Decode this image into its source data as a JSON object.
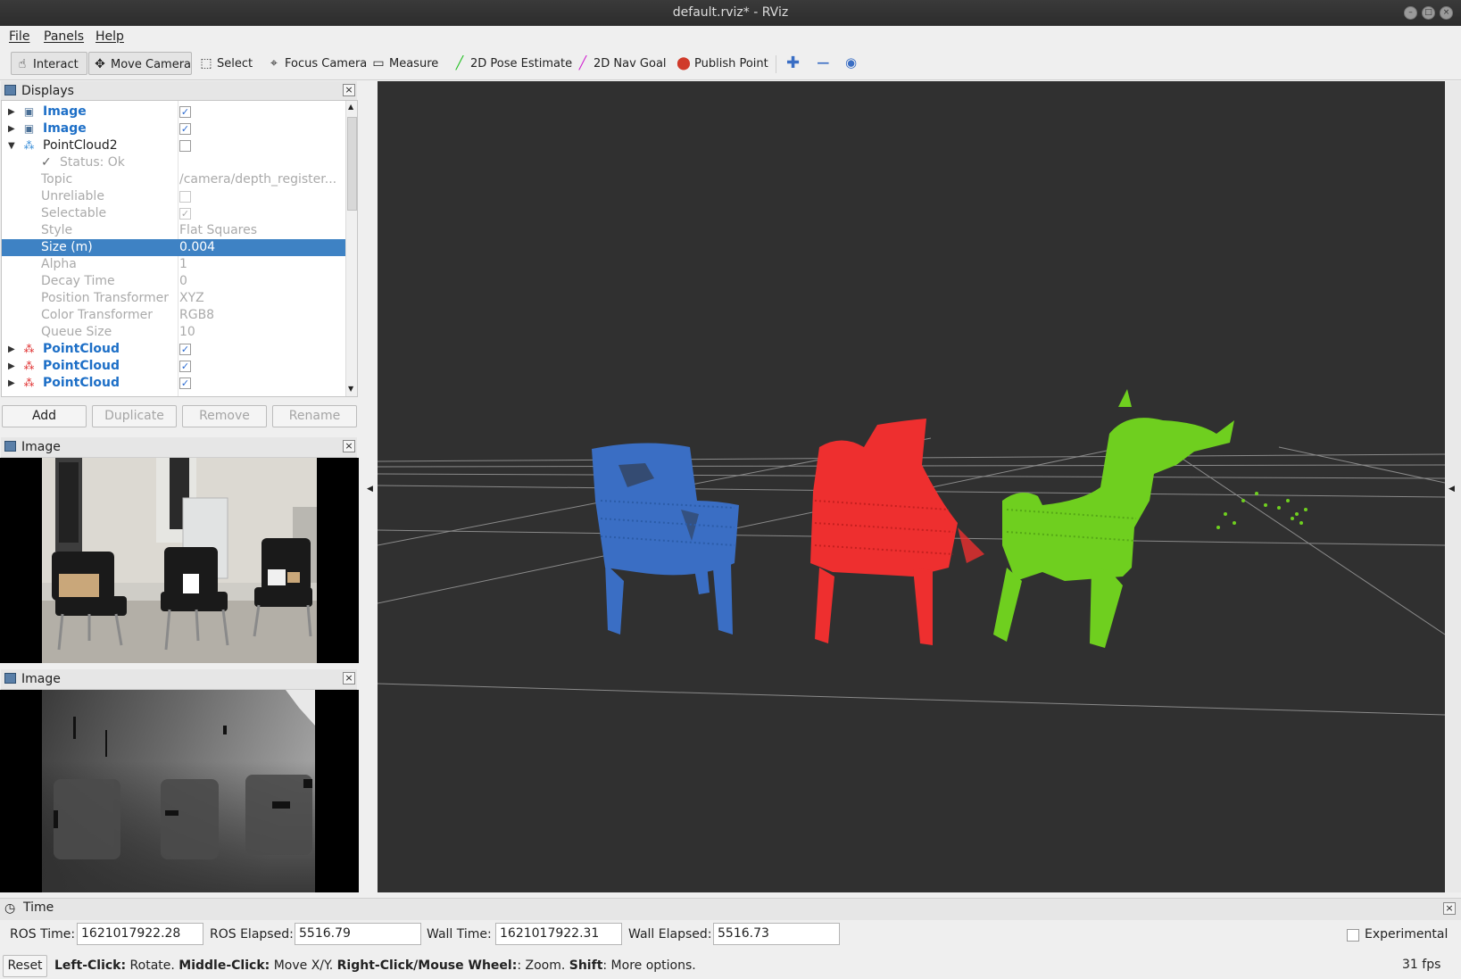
{
  "window": {
    "title": "default.rviz* - RViz"
  },
  "menu": {
    "file": "File",
    "panels": "Panels",
    "help": "Help"
  },
  "toolbar": {
    "interact": "Interact",
    "move_camera": "Move Camera",
    "select": "Select",
    "focus_camera": "Focus Camera",
    "measure": "Measure",
    "pose_estimate": "2D Pose Estimate",
    "nav_goal": "2D Nav Goal",
    "publish_point": "Publish Point"
  },
  "displays": {
    "title": "Displays",
    "rows": [
      {
        "label": "Image",
        "checked": true
      },
      {
        "label": "Image",
        "checked": true
      },
      {
        "label": "PointCloud2",
        "checked": false
      },
      {
        "label": "Status: Ok"
      },
      {
        "label": "Topic",
        "value": "/camera/depth_register..."
      },
      {
        "label": "Unreliable",
        "checked": false
      },
      {
        "label": "Selectable",
        "checked": true
      },
      {
        "label": "Style",
        "value": "Flat Squares"
      },
      {
        "label": "Size (m)",
        "value": "0.004"
      },
      {
        "label": "Alpha",
        "value": "1"
      },
      {
        "label": "Decay Time",
        "value": "0"
      },
      {
        "label": "Position Transformer",
        "value": "XYZ"
      },
      {
        "label": "Color Transformer",
        "value": "RGB8"
      },
      {
        "label": "Queue Size",
        "value": "10"
      },
      {
        "label": "PointCloud",
        "checked": true
      },
      {
        "label": "PointCloud",
        "checked": true
      },
      {
        "label": "PointCloud",
        "checked": true
      }
    ],
    "buttons": {
      "add": "Add",
      "duplicate": "Duplicate",
      "remove": "Remove",
      "rename": "Rename"
    }
  },
  "image_panels": [
    {
      "title": "Image"
    },
    {
      "title": "Image"
    }
  ],
  "time_panel": {
    "title": "Time",
    "ros_time_label": "ROS Time:",
    "ros_time": "1621017922.28",
    "ros_elapsed_label": "ROS Elapsed:",
    "ros_elapsed": "5516.79",
    "wall_time_label": "Wall Time:",
    "wall_time": "1621017922.31",
    "wall_elapsed_label": "Wall Elapsed:",
    "wall_elapsed": "5516.73",
    "experimental": "Experimental"
  },
  "status": {
    "reset": "Reset",
    "left_click": "Left-Click:",
    "left_click_desc": " Rotate. ",
    "middle_click": "Middle-Click:",
    "middle_click_desc": " Move X/Y. ",
    "right_click": "Right-Click/Mouse Wheel:",
    "right_click_desc": ": Zoom. ",
    "shift": "Shift",
    "shift_desc": ": More options.",
    "fps": "31 fps"
  },
  "colors": {
    "cloud_blue": "#3a6ec4",
    "cloud_red": "#ee2f2f",
    "cloud_green": "#6fcf1f",
    "selection": "#3e82c4",
    "viewport_bg": "#303030"
  }
}
